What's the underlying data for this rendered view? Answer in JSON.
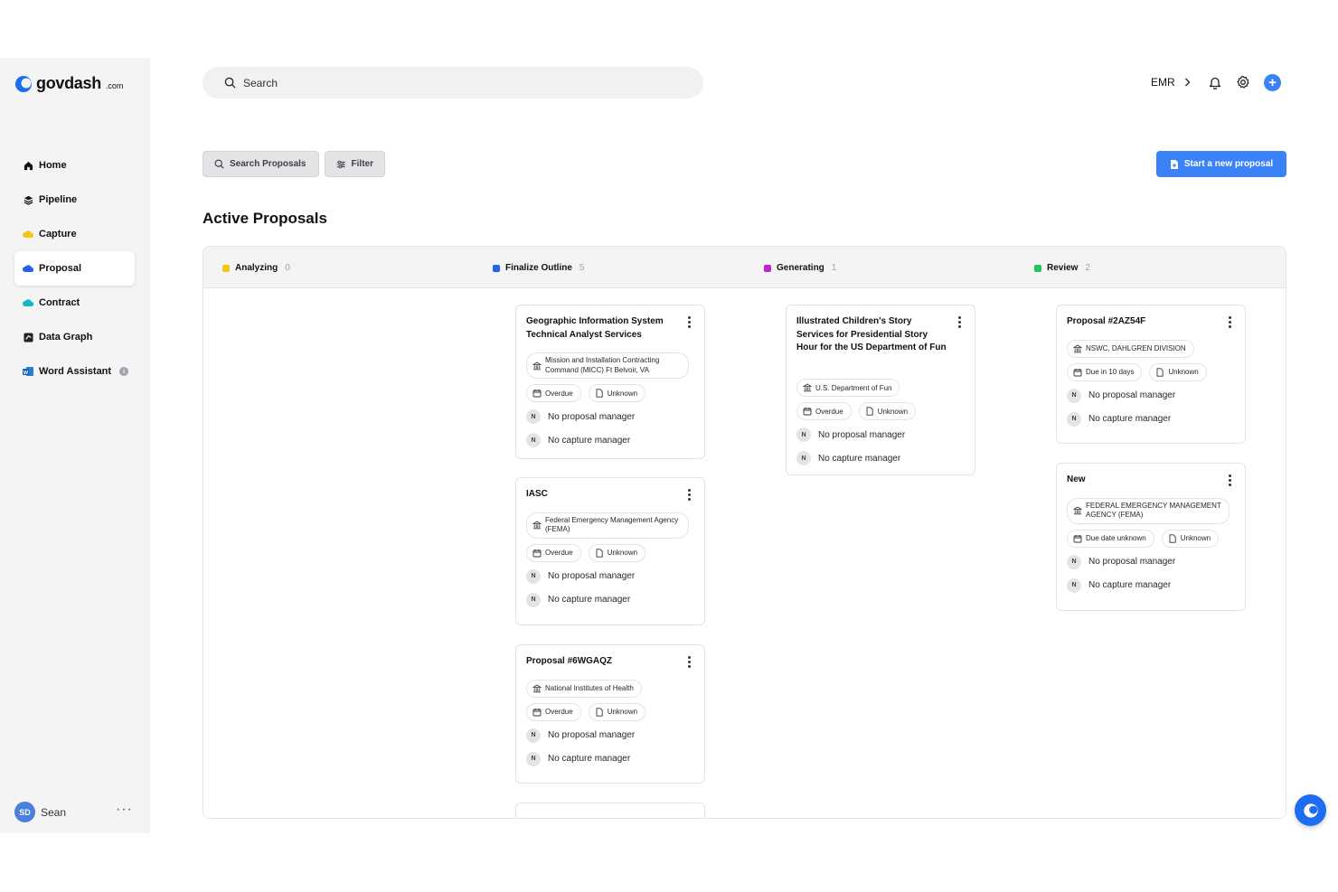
{
  "brand": {
    "name": "govdash",
    "suffix": ".com"
  },
  "sidebar": {
    "items": [
      {
        "label": "Home"
      },
      {
        "label": "Pipeline"
      },
      {
        "label": "Capture"
      },
      {
        "label": "Proposal"
      },
      {
        "label": "Contract"
      },
      {
        "label": "Data Graph"
      },
      {
        "label": "Word Assistant"
      }
    ],
    "user": {
      "initials": "SD",
      "name": "Sean"
    }
  },
  "topbar": {
    "search_placeholder": "Search",
    "org": "EMR"
  },
  "toolbar": {
    "search_label": "Search Proposals",
    "filter_label": "Filter",
    "new_label": "Start a new proposal"
  },
  "page": {
    "title": "Active Proposals"
  },
  "board": {
    "columns": [
      {
        "label": "Analyzing",
        "count": "0",
        "color": "#f5c518"
      },
      {
        "label": "Finalize Outline",
        "count": "5",
        "color": "#2563eb"
      },
      {
        "label": "Generating",
        "count": "1",
        "color": "#c026d3"
      },
      {
        "label": "Review",
        "count": "2",
        "color": "#22c55e"
      }
    ],
    "cards": [
      {
        "title": "Geographic Information System Technical Analyst Services",
        "agency": "Mission and Installation Contracting Command (MICC) Ft Belvoir, VA",
        "due": "Overdue",
        "type": "Unknown",
        "pm": "No proposal manager",
        "cm": "No capture manager"
      },
      {
        "title": "IASC",
        "agency": "Federal Emergency Management Agency (FEMA)",
        "due": "Overdue",
        "type": "Unknown",
        "pm": "No proposal manager",
        "cm": "No capture manager"
      },
      {
        "title": "Proposal #6WGAQZ",
        "agency": "National Institutes of Health",
        "due": "Overdue",
        "type": "Unknown",
        "pm": "No proposal manager",
        "cm": "No capture manager"
      },
      {
        "title": "Illustrated Children's Story Services for Presidential Story Hour for the US Department of Fun",
        "agency": "U.S. Department of Fun",
        "due": "Overdue",
        "type": "Unknown",
        "pm": "No proposal manager",
        "cm": "No capture manager"
      },
      {
        "title": "Proposal #2AZ54F",
        "agency": "NSWC, DAHLGREN DIVISION",
        "due": "Due in 10 days",
        "type": "Unknown",
        "pm": "No proposal manager",
        "cm": "No capture manager"
      },
      {
        "title": "New",
        "agency": "FEDERAL EMERGENCY MANAGEMENT AGENCY (FEMA)",
        "due": "Due date unknown",
        "type": "Unknown",
        "pm": "No proposal manager",
        "cm": "No capture manager"
      }
    ],
    "person_initial": "N"
  },
  "icons": [
    "home-icon",
    "pipeline-icon",
    "capture-icon",
    "proposal-icon",
    "contract-icon",
    "data-graph-icon",
    "word-icon",
    "search-icon",
    "bell-icon",
    "gear-icon",
    "plus-icon",
    "filter-icon",
    "building-icon",
    "calendar-icon",
    "document-icon",
    "kebab-icon",
    "chat-icon"
  ]
}
